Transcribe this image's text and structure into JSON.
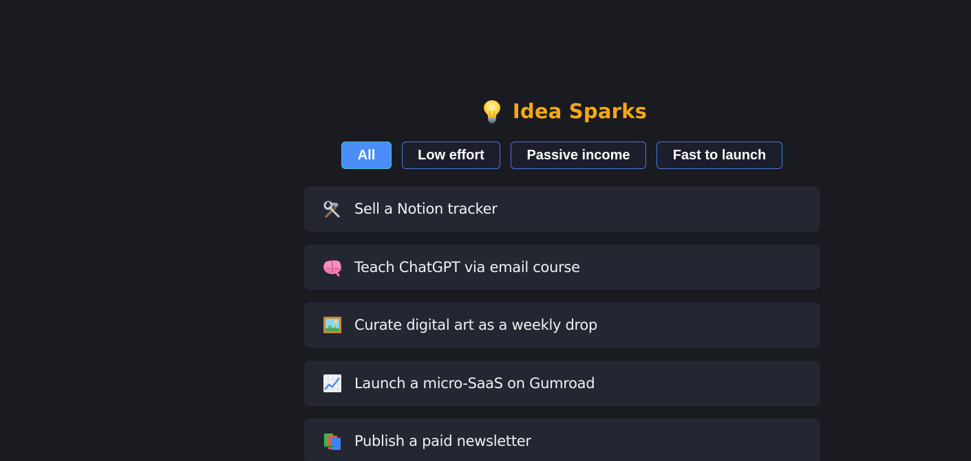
{
  "header": {
    "icon": "lightbulb-icon",
    "title": "Idea Sparks",
    "accent_color": "#f5a814"
  },
  "filters": [
    {
      "label": "All",
      "active": true
    },
    {
      "label": "Low effort",
      "active": false
    },
    {
      "label": "Passive income",
      "active": false
    },
    {
      "label": "Fast to launch",
      "active": false
    }
  ],
  "ideas": [
    {
      "icon": "hammer-wrench-icon",
      "label": "Sell a Notion tracker"
    },
    {
      "icon": "brain-icon",
      "label": "Teach ChatGPT via email course"
    },
    {
      "icon": "framed-picture-icon",
      "label": "Curate digital art as a weekly drop"
    },
    {
      "icon": "chart-increasing-icon",
      "label": "Launch a micro-SaaS on Gumroad"
    },
    {
      "icon": "books-icon",
      "label": "Publish a paid newsletter"
    }
  ]
}
